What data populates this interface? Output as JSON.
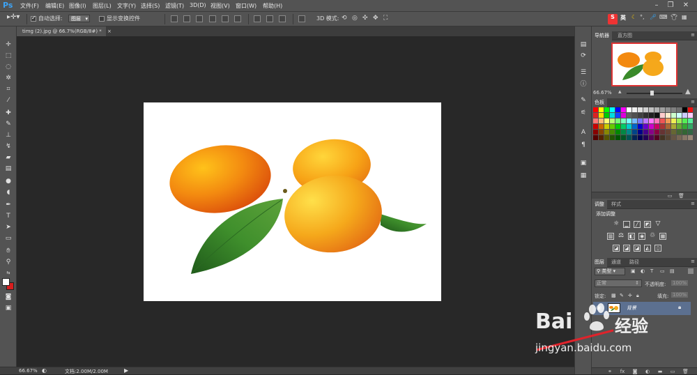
{
  "app": {
    "logo": "Ps"
  },
  "menubar": {
    "items": [
      "文件(F)",
      "编辑(E)",
      "图像(I)",
      "图层(L)",
      "文字(Y)",
      "选择(S)",
      "滤镜(T)",
      "3D(D)",
      "视图(V)",
      "窗口(W)",
      "帮助(H)"
    ]
  },
  "options": {
    "auto_select_label": "自动选择:",
    "auto_select_value": "图层",
    "show_transform_label": "显示变换控件",
    "mode_3d_label": "3D 模式:"
  },
  "tray": {
    "ime_label": "英"
  },
  "document": {
    "tab_title": "timg (2).jpg @ 66.7%(RGB/8#) *",
    "close_glyph": "×"
  },
  "status": {
    "zoom": "66.67%",
    "doc_info": "文档:2.00M/2.00M"
  },
  "navigator": {
    "tabs": [
      "导航器",
      "直方图"
    ],
    "zoom": "66.67%"
  },
  "swatches": {
    "tab": "色板",
    "colors": [
      "#ff0000",
      "#ffff00",
      "#00ff00",
      "#00ffff",
      "#0000ff",
      "#ff00ff",
      "#ffffff",
      "#f0f0f0",
      "#e0e0e0",
      "#d0d0d0",
      "#c0c0c0",
      "#b0b0b0",
      "#a0a0a0",
      "#909090",
      "#808080",
      "#707070",
      "#000000",
      "#ee1111",
      "#dd2222",
      "#ffdd00",
      "#00cc00",
      "#00dddd",
      "#1144ff",
      "#dd00dd",
      "#606060",
      "#505050",
      "#404040",
      "#303030",
      "#202020",
      "#101010",
      "#ffcccc",
      "#ffeecc",
      "#ccffcc",
      "#ccffff",
      "#ccccff",
      "#ffccff",
      "#ff7777",
      "#ffbb77",
      "#ffff77",
      "#bbff77",
      "#77ff77",
      "#77ffbb",
      "#77ffff",
      "#77bbff",
      "#7777ff",
      "#bb77ff",
      "#ff77ff",
      "#ff77bb",
      "#ee5555",
      "#ee9955",
      "#eeee55",
      "#99ee55",
      "#55ee55",
      "#55ee99",
      "#cc0000",
      "#cc6600",
      "#cccc00",
      "#66cc00",
      "#00cc00",
      "#00cc66",
      "#00cccc",
      "#0066cc",
      "#0000cc",
      "#6600cc",
      "#cc00cc",
      "#cc0066",
      "#aa3333",
      "#aa6633",
      "#aaaa33",
      "#66aa33",
      "#33aa33",
      "#33aa66",
      "#880000",
      "#884400",
      "#888800",
      "#448800",
      "#008800",
      "#008844",
      "#008888",
      "#004488",
      "#000088",
      "#440088",
      "#880088",
      "#880044",
      "#663333",
      "#664433",
      "#666633",
      "#446633",
      "#336633",
      "#336644",
      "#550000",
      "#552200",
      "#555500",
      "#225500",
      "#005500",
      "#005522",
      "#005555",
      "#002255",
      "#000055",
      "#220055",
      "#550055",
      "#550022",
      "#443322",
      "#554433",
      "#665544",
      "#776655",
      "#887766",
      "#998877"
    ]
  },
  "adjustments": {
    "tabs": [
      "调整",
      "样式"
    ],
    "add_label": "添加调整"
  },
  "layers": {
    "tabs": [
      "图层",
      "通道",
      "路径"
    ],
    "filter_kind": "类型",
    "blend_mode": "正常",
    "opacity_label": "不透明度:",
    "opacity_value": "100%",
    "lock_label": "锁定:",
    "fill_label": "填充:",
    "fill_value": "100%",
    "layer_name": "背景"
  },
  "watermark": {
    "brand_text": "Bai",
    "brand_suffix": "经验",
    "url": "jingyan.baidu.com"
  }
}
